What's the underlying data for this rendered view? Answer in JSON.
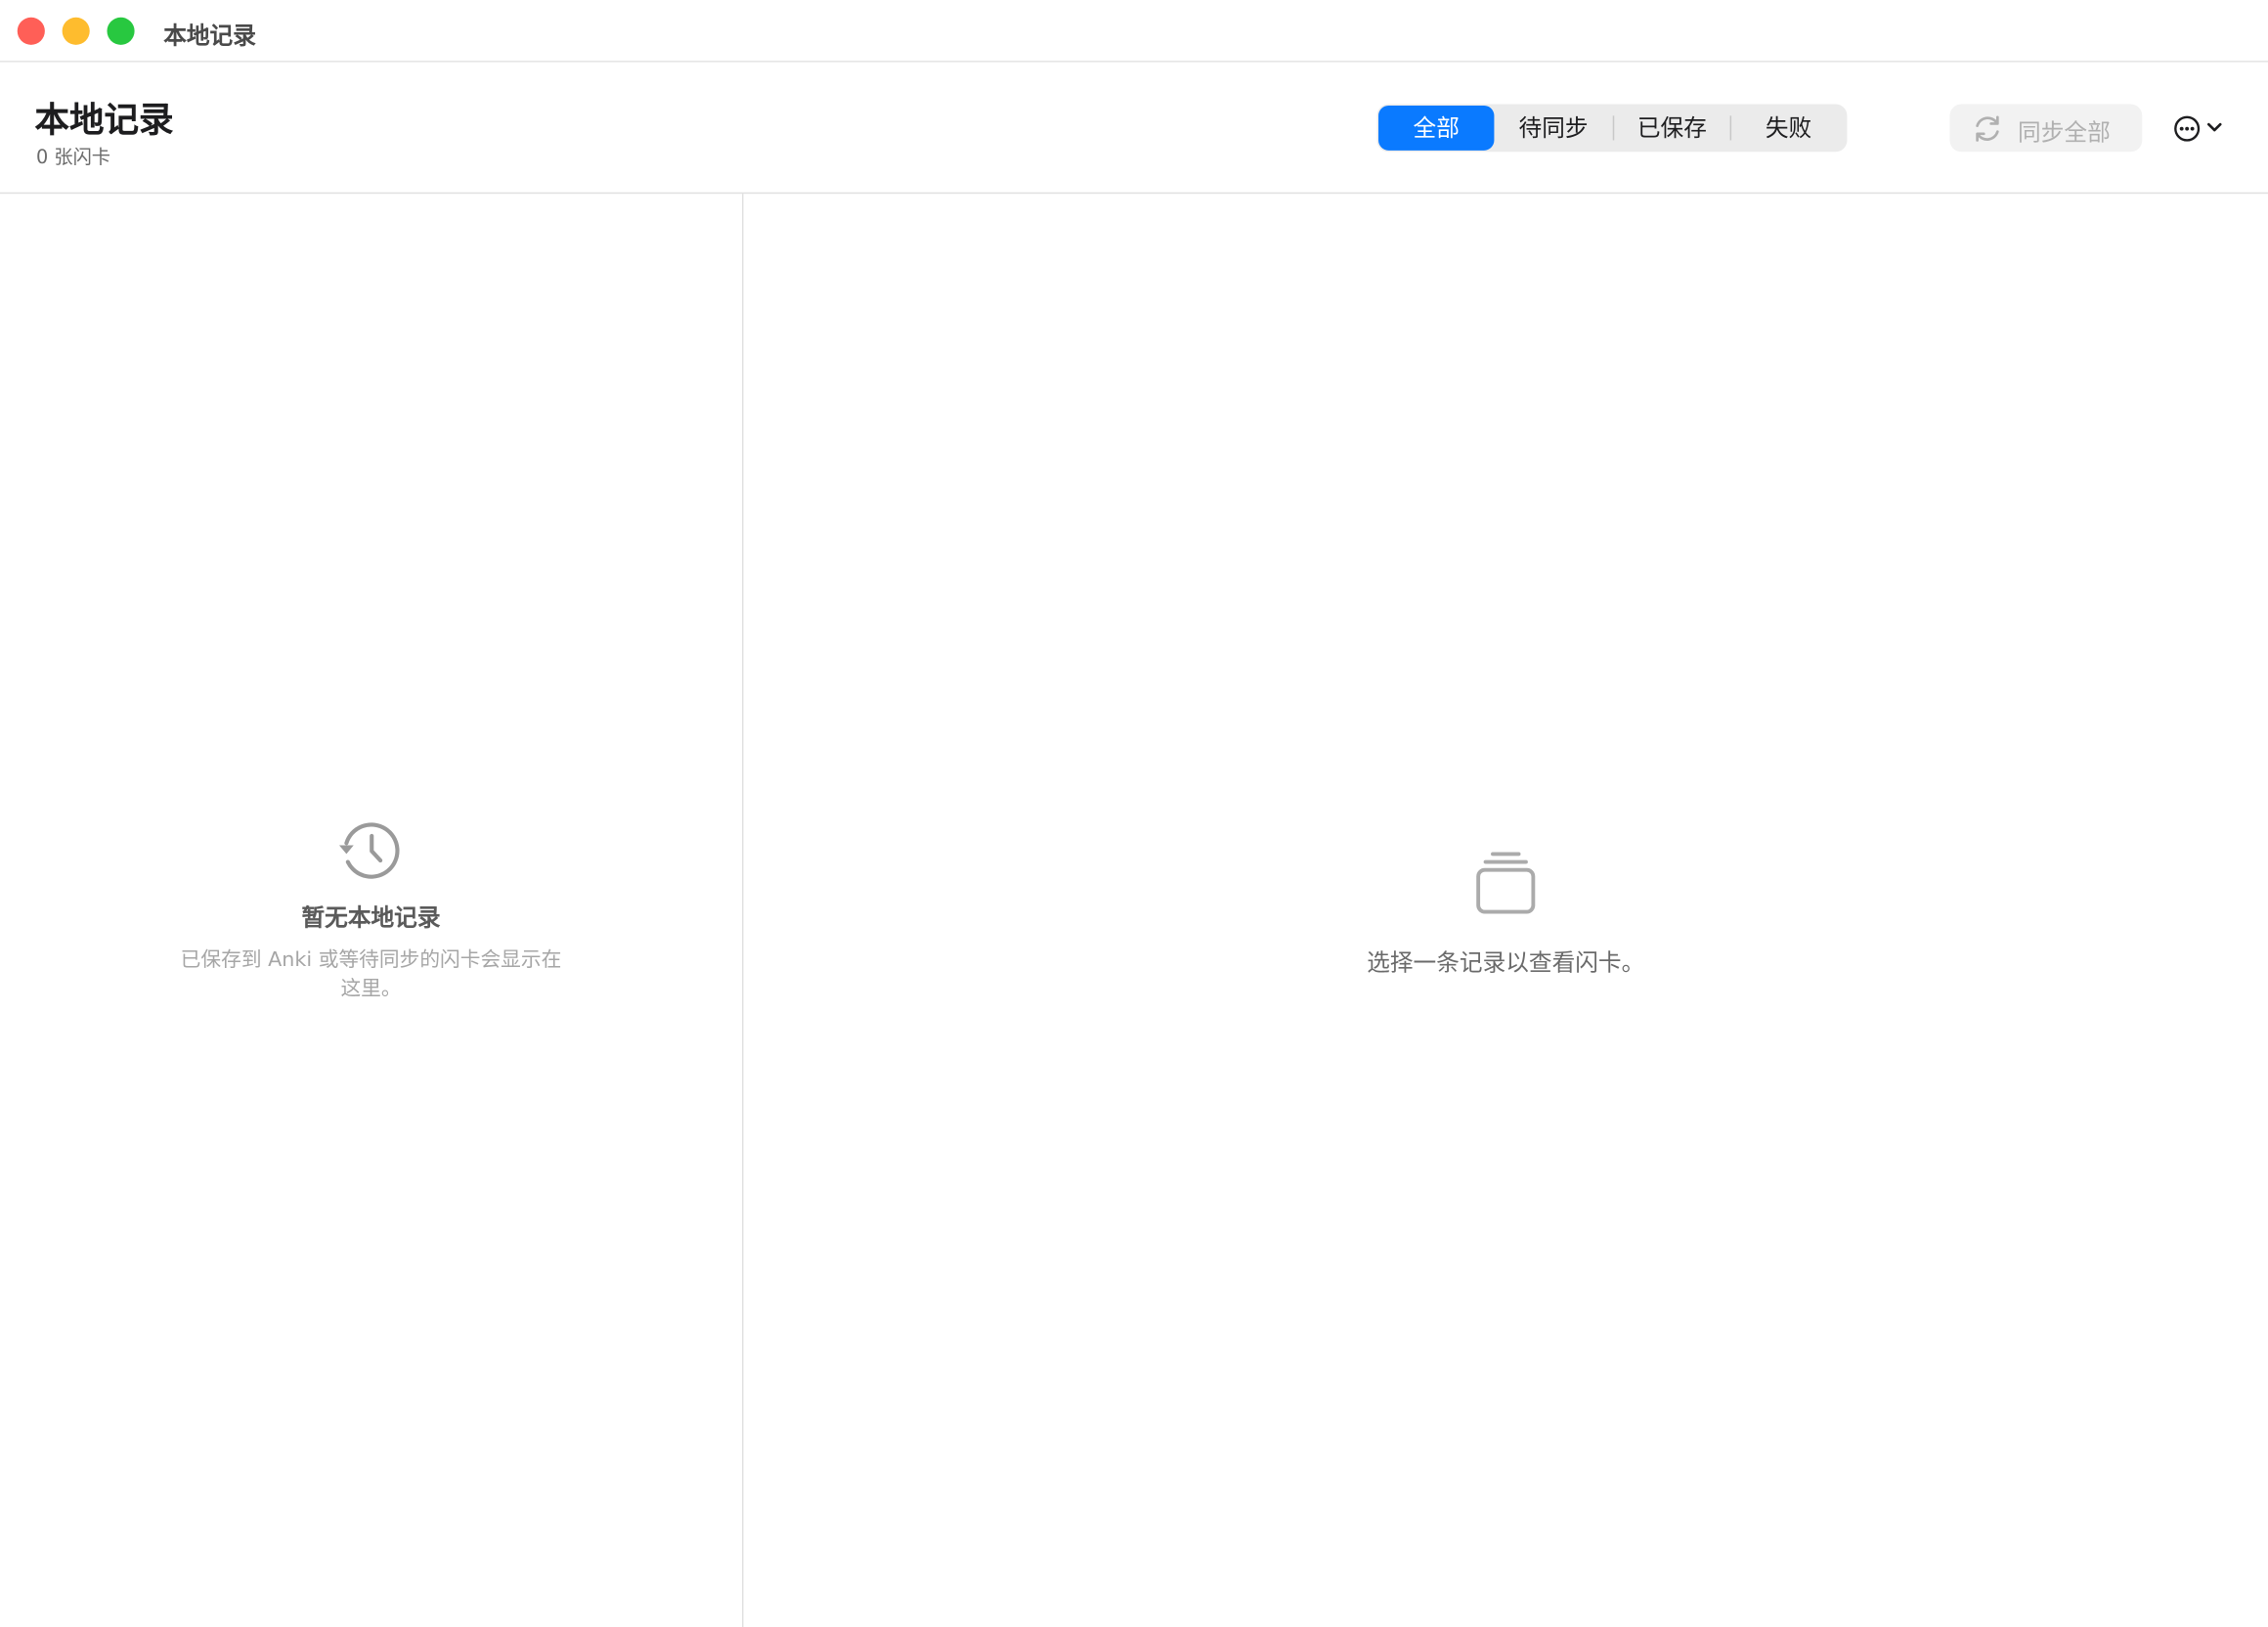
{
  "window": {
    "title": "本地记录"
  },
  "header": {
    "title": "本地记录",
    "subtitle": "0 张闪卡"
  },
  "filters": {
    "all": "全部",
    "pending": "待同步",
    "saved": "已保存",
    "failed": "失败",
    "selected": "全部"
  },
  "toolbar": {
    "sync_all_label": "同步全部",
    "more_icon": "ellipsis-circle-icon"
  },
  "list": {
    "empty_icon": "history-icon",
    "empty_title": "暂无本地记录",
    "empty_desc": "已保存到 Anki 或等待同步的闪卡会显示在这里。"
  },
  "detail": {
    "icon": "cards-stack-icon",
    "hint": "选择一条记录以查看闪卡。"
  },
  "colors": {
    "accent": "#0A7AFF",
    "close": "#FF5F57",
    "minimize": "#FEBC2E",
    "zoom": "#28C840"
  }
}
